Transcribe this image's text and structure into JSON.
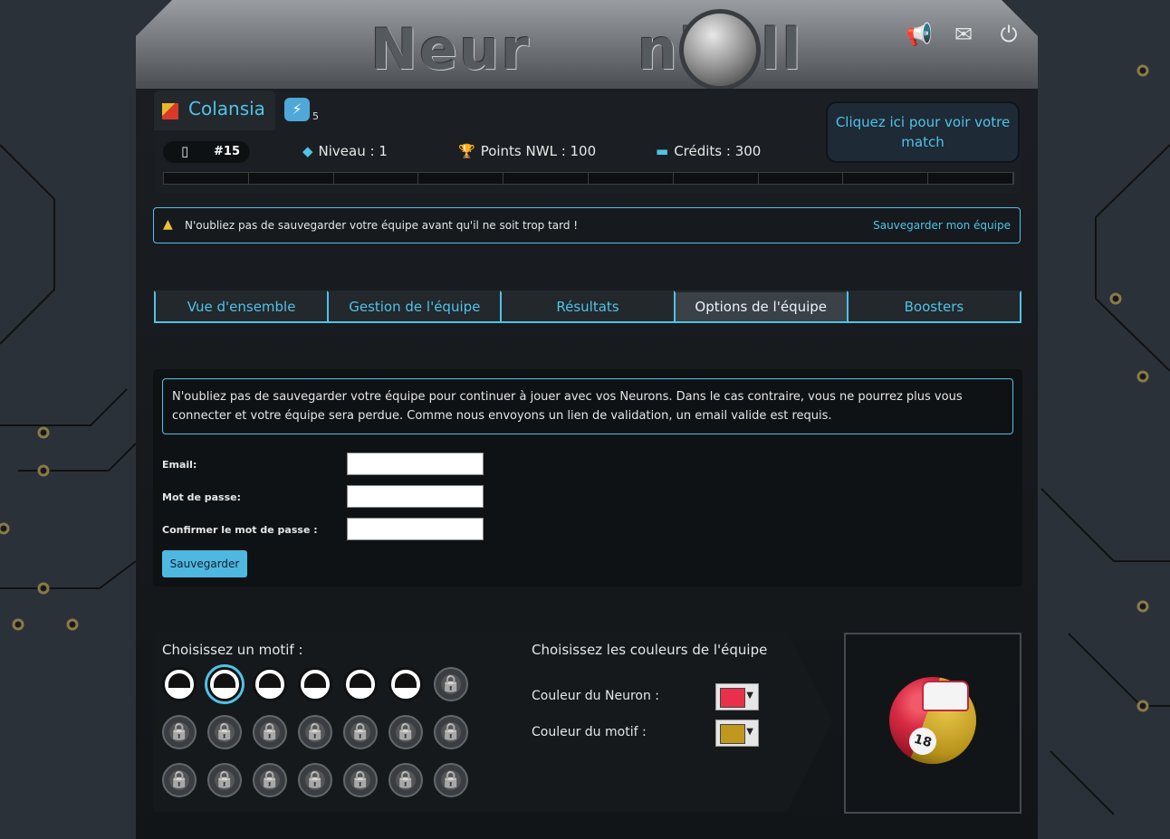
{
  "header": {
    "logo": "Neuronball",
    "icons": [
      "megaphone-icon",
      "mail-icon",
      "power-icon"
    ]
  },
  "team": {
    "name": "Colansia",
    "boost_count": "5",
    "rank": "#15",
    "level_label": "Niveau : 1",
    "points_label": "Points NWL : 100",
    "credits_label": "Crédits : 300",
    "match_button": "Cliquez ici pour voir votre match"
  },
  "alert": {
    "text": "N'oubliez pas de sauvegarder votre équipe avant qu'il ne soit trop tard !",
    "link": "Sauvegarder mon équipe"
  },
  "tabs": [
    {
      "label": "Vue d'ensemble",
      "active": false
    },
    {
      "label": "Gestion de l'équipe",
      "active": false
    },
    {
      "label": "Résultats",
      "active": false
    },
    {
      "label": "Options de l'équipe",
      "active": true
    },
    {
      "label": "Boosters",
      "active": false
    }
  ],
  "save_form": {
    "info": "N'oubliez pas de sauvegarder votre équipe pour continuer à jouer avec vos Neurons. Dans le cas contraire, vous ne pourrez plus vous connecter et votre équipe sera perdue. Comme nous envoyons un lien de validation, un email valide est requis.",
    "email_label": "Email:",
    "password_label": "Mot de passe:",
    "confirm_label": "Confirmer le mot de passe :",
    "email_value": "",
    "password_value": "",
    "confirm_value": "",
    "save_button": "Sauvegarder"
  },
  "customize": {
    "motif_title": "Choisissez un motif :",
    "colors_title": "Choisissez les couleurs de l'équipe",
    "neuron_color_label": "Couleur du Neuron :",
    "motif_color_label": "Couleur du motif :",
    "neuron_color": "#e8304a",
    "motif_color": "#c0981e",
    "open_motifs": 6,
    "selected_motif": 2,
    "total_motifs": 21
  },
  "preview": {
    "ball_number": "18"
  }
}
